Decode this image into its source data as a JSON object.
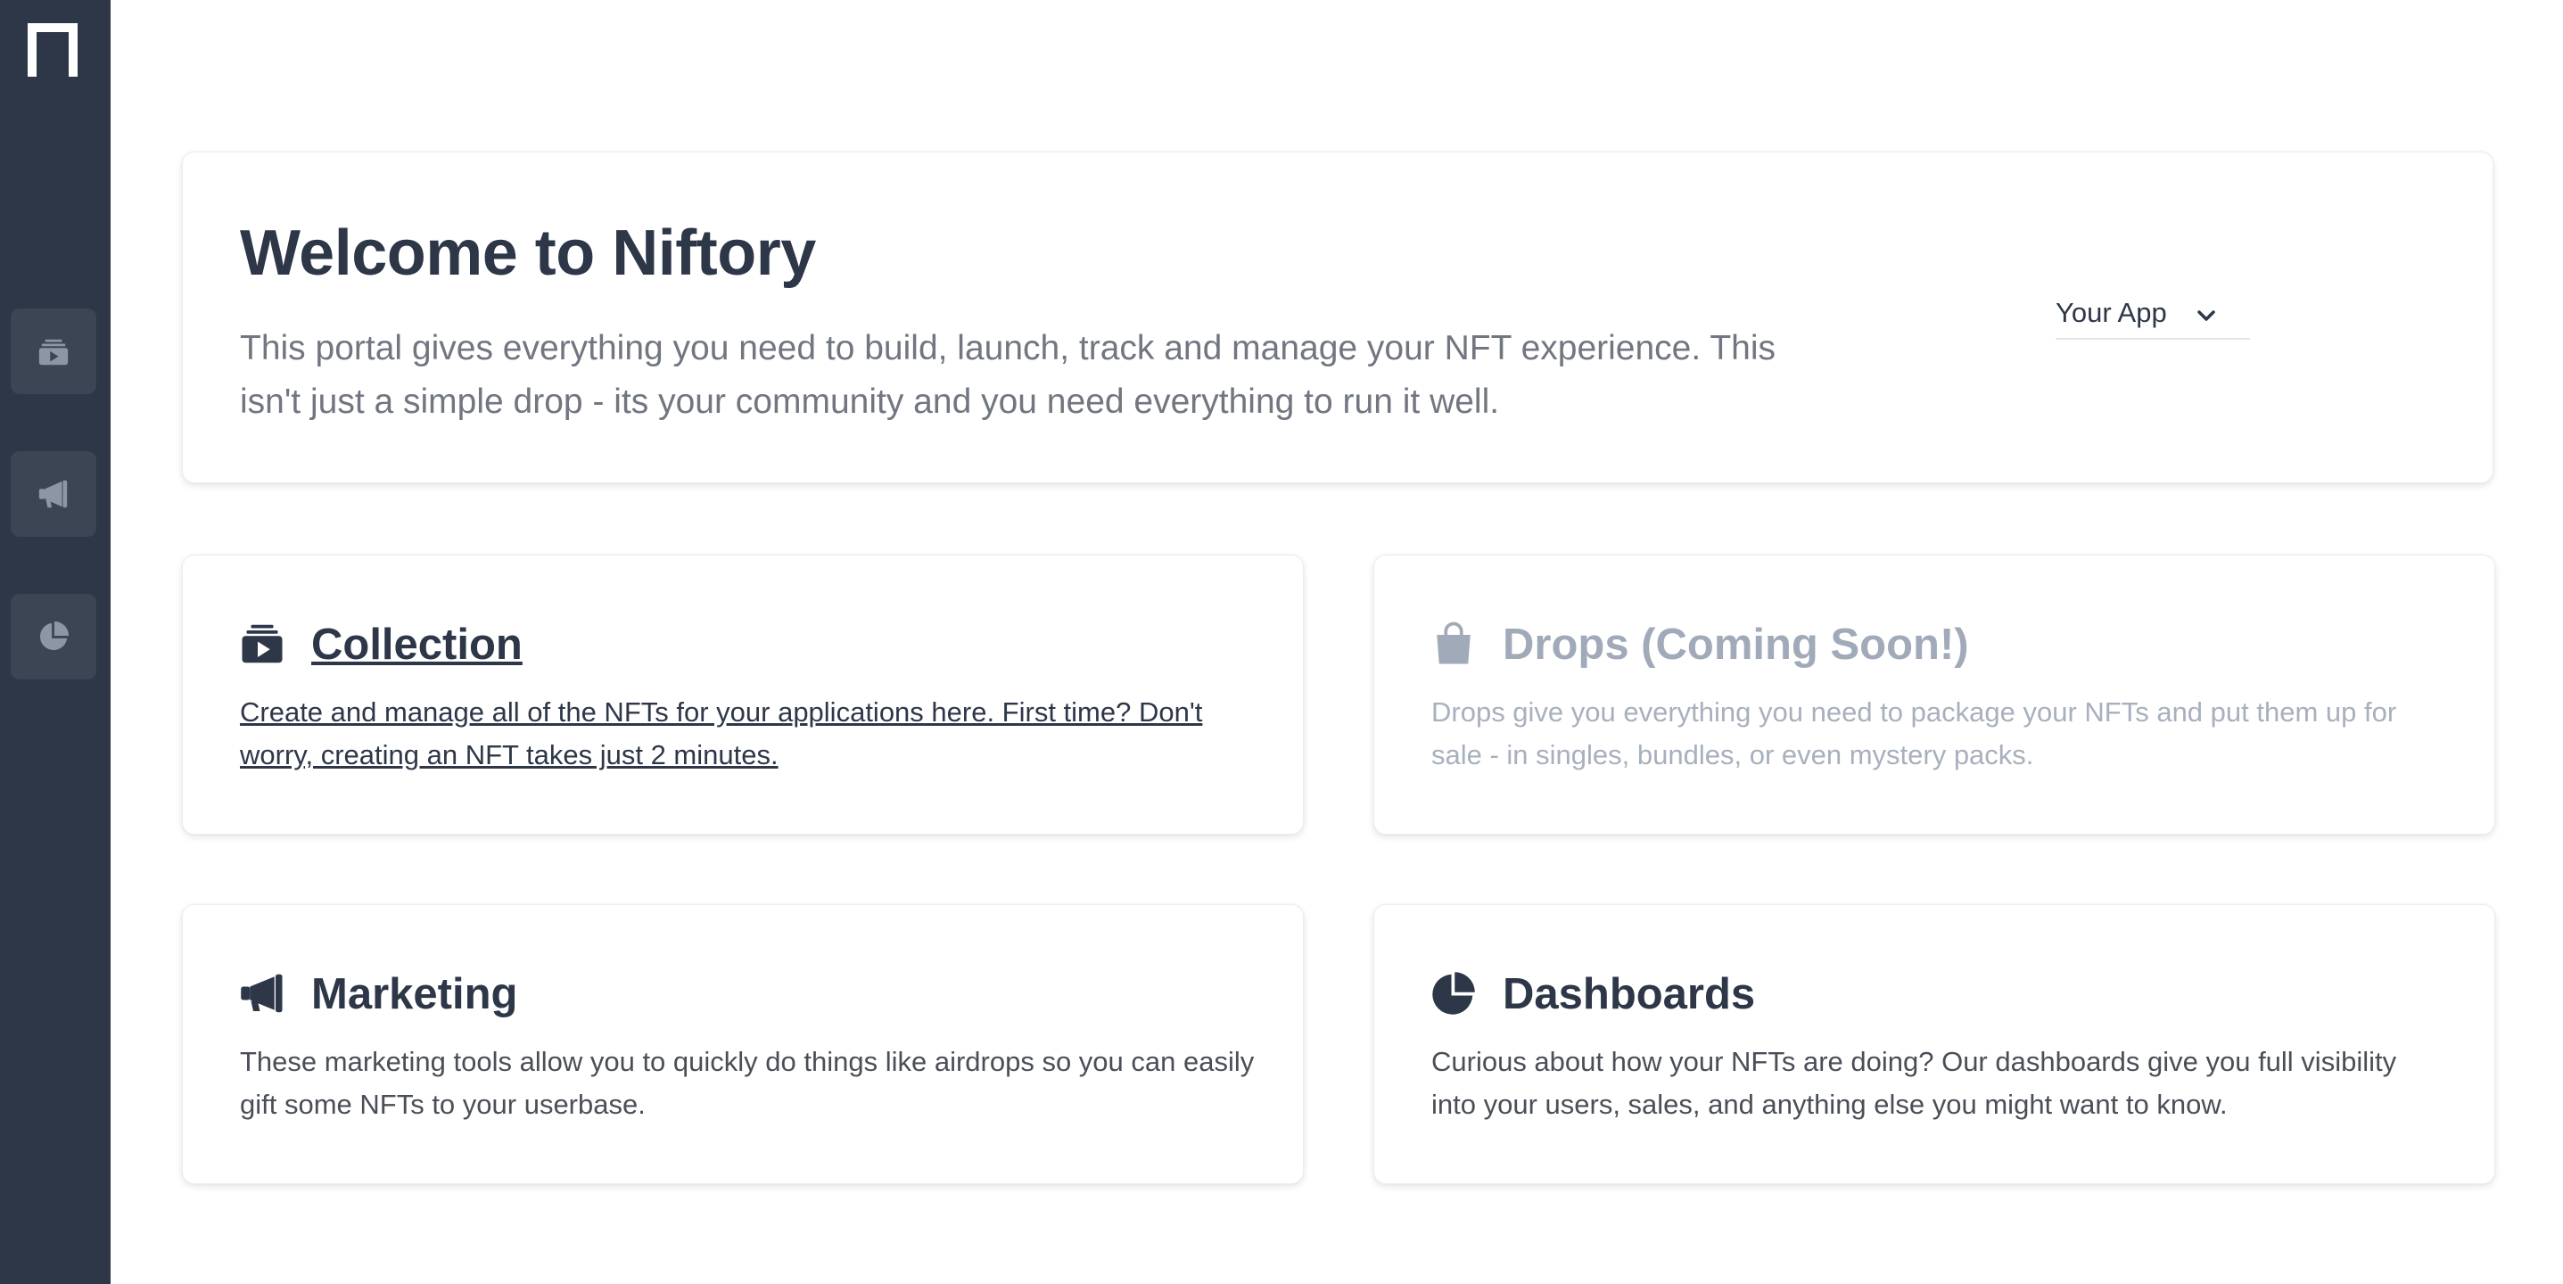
{
  "sidebar": {
    "logo_icon": "niftory-n-logo",
    "items": [
      {
        "icon": "collection-icon"
      },
      {
        "icon": "megaphone-icon"
      },
      {
        "icon": "pie-chart-icon"
      }
    ],
    "background": "#2d3748"
  },
  "hero": {
    "title": "Welcome to Niftory",
    "description": "This portal gives everything you need to build, launch, track and manage your NFT experience. This isn't just a simple drop - its your community and you need everything to run it well.",
    "app_select": {
      "value": "Your App",
      "icon": "chevron-down-icon"
    }
  },
  "features": [
    {
      "icon": "collection-icon",
      "title": "Collection",
      "description": "Create and manage all of the NFTs for your applications here. First time? Don't worry, creating an NFT takes just 2 minutes.",
      "state": "link"
    },
    {
      "icon": "shopping-bag-icon",
      "title": "Drops (Coming Soon!)",
      "description": "Drops give you everything you need to package your NFTs and put them up for sale - in singles, bundles, or even mystery packs.",
      "state": "disabled"
    },
    {
      "icon": "megaphone-icon",
      "title": "Marketing",
      "description": "These marketing tools allow you to quickly do things like airdrops so you can easily gift some NFTs to your userbase.",
      "state": "normal"
    },
    {
      "icon": "pie-chart-icon",
      "title": "Dashboards",
      "description": "Curious about how your NFTs are doing? Our dashboards give you full visibility into your users, sales, and anything else you might want to know.",
      "state": "normal"
    }
  ],
  "colors": {
    "text_dark": "#2d3748",
    "text_muted": "#717680",
    "disabled": "#a0aab9"
  }
}
